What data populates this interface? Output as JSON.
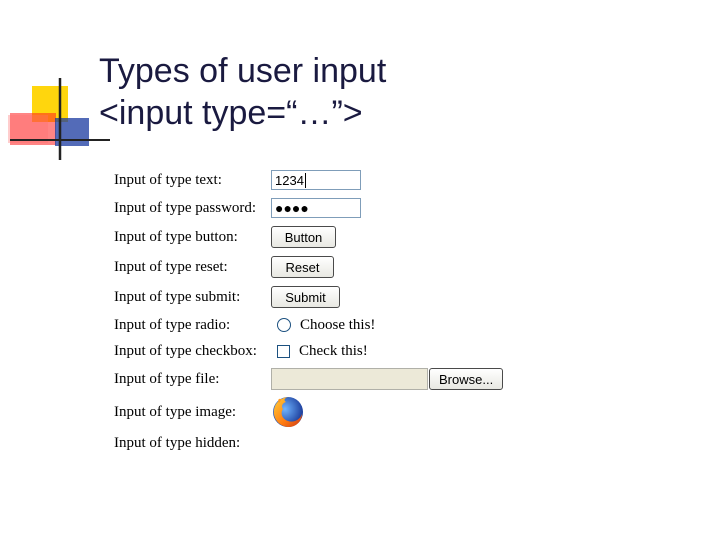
{
  "title": {
    "line1": "Types of user input",
    "line2": "<input type=“…”>"
  },
  "rows": [
    {
      "label": "Input of type text:",
      "value": "1234"
    },
    {
      "label": "Input of type password:",
      "value": "●●●●"
    },
    {
      "label": "Input of type button:",
      "button": "Button"
    },
    {
      "label": "Input of type reset:",
      "button": "Reset"
    },
    {
      "label": "Input of type submit:",
      "button": "Submit"
    },
    {
      "label": "Input of type radio:",
      "option": "Choose this!"
    },
    {
      "label": "Input of type checkbox:",
      "option": "Check this!"
    },
    {
      "label": "Input of type file:",
      "button": "Browse..."
    },
    {
      "label": "Input of type image:",
      "icon": "firefox-logo-icon"
    },
    {
      "label": "Input of type hidden:"
    }
  ],
  "colors": {
    "deco_yellow": "#ffd400",
    "deco_red": "#ff2020",
    "deco_blue": "#1a3aa0",
    "title_text": "#1a1a40"
  }
}
